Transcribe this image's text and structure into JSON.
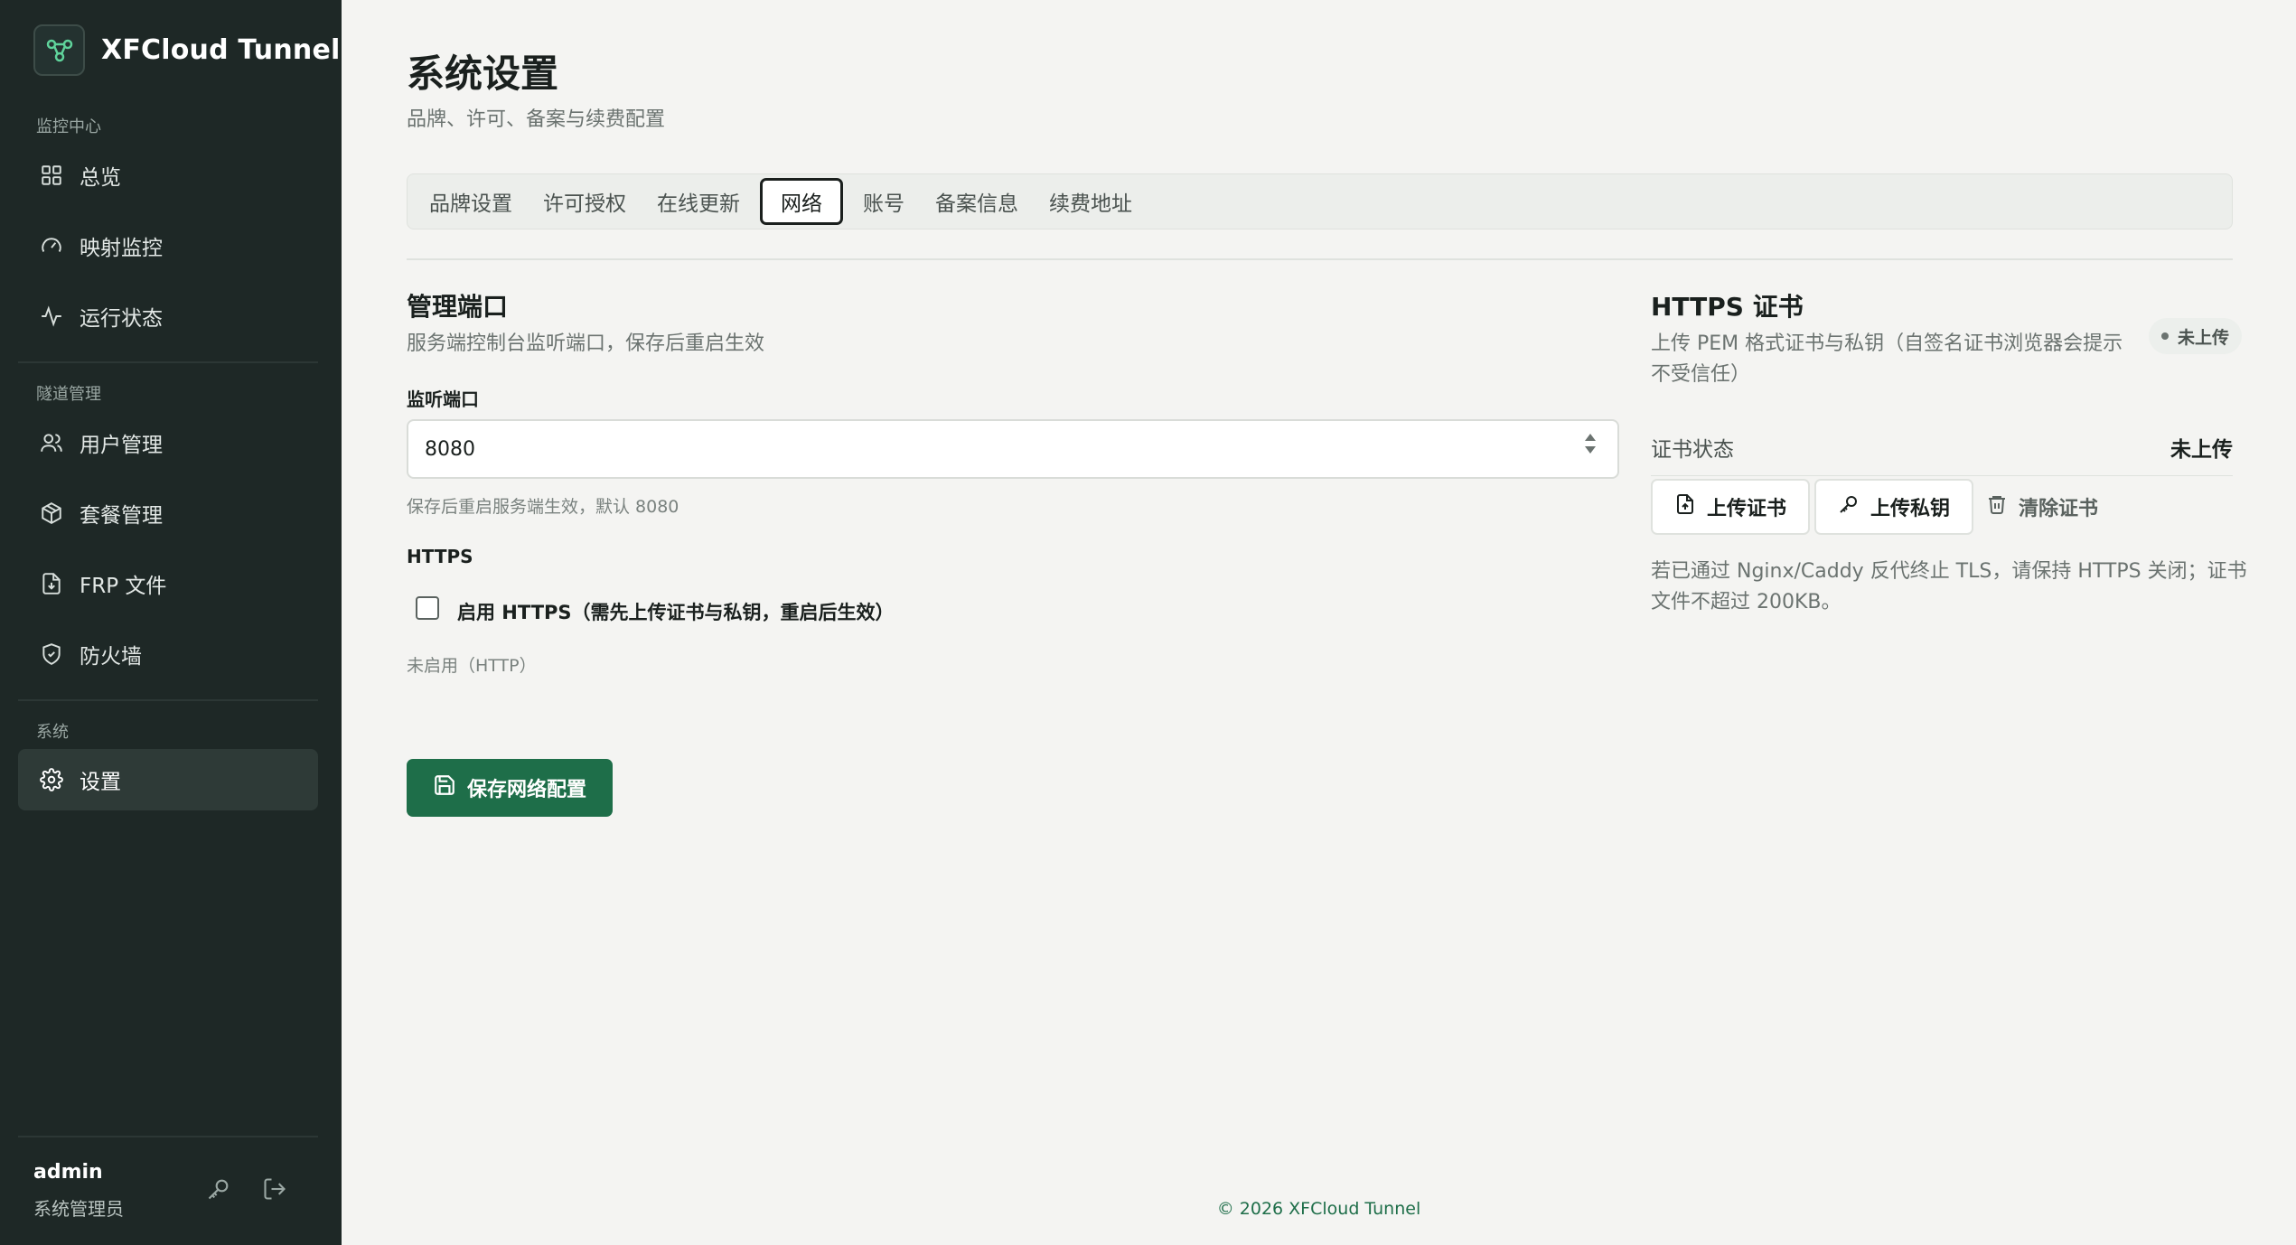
{
  "app": {
    "name": "XFCloud Tunnel"
  },
  "sidebar": {
    "sections": [
      {
        "label": "监控中心",
        "items": [
          {
            "label": "总览",
            "icon": "grid-icon"
          },
          {
            "label": "映射监控",
            "icon": "gauge-icon"
          },
          {
            "label": "运行状态",
            "icon": "activity-icon"
          }
        ]
      },
      {
        "label": "隧道管理",
        "items": [
          {
            "label": "用户管理",
            "icon": "users-icon"
          },
          {
            "label": "套餐管理",
            "icon": "package-icon"
          },
          {
            "label": "FRP 文件",
            "icon": "file-download-icon"
          },
          {
            "label": "防火墙",
            "icon": "shield-icon"
          }
        ]
      },
      {
        "label": "系统",
        "items": [
          {
            "label": "设置",
            "icon": "gear-icon",
            "active": true
          }
        ]
      }
    ],
    "user": {
      "name": "admin",
      "role": "系统管理员"
    }
  },
  "page": {
    "title": "系统设置",
    "subtitle": "品牌、许可、备案与续费配置"
  },
  "tabs": [
    {
      "label": "品牌设置"
    },
    {
      "label": "许可授权"
    },
    {
      "label": "在线更新"
    },
    {
      "label": "网络",
      "active": true
    },
    {
      "label": "账号"
    },
    {
      "label": "备案信息"
    },
    {
      "label": "续费地址"
    }
  ],
  "port_section": {
    "title": "管理端口",
    "desc": "服务端控制台监听端口，保存后重启生效",
    "field_label": "监听端口",
    "port_value": "8080",
    "hint": "保存后重启服务端生效，默认 8080"
  },
  "https_section": {
    "label": "HTTPS",
    "checkbox_label": "启用 HTTPS（需先上传证书与私钥，重启后生效）",
    "checked": false,
    "status_hint": "未启用（HTTP）"
  },
  "save_button": {
    "label": "保存网络配置"
  },
  "cert_section": {
    "title": "HTTPS 证书",
    "desc": "上传 PEM 格式证书与私钥（自签名证书浏览器会提示不受信任）",
    "badge": "未上传",
    "status_label": "证书状态",
    "status_value": "未上传",
    "upload_cert": "上传证书",
    "upload_key": "上传私钥",
    "clear_cert": "清除证书",
    "note": "若已通过 Nginx/Caddy 反代终止 TLS，请保持 HTTPS 关闭；证书文件不超过 200KB。"
  },
  "footer": {
    "text": "© 2026 XFCloud Tunnel"
  },
  "colors": {
    "sidebar_bg": "#1e2826",
    "accent": "#1e6e49",
    "page_bg": "#f4f4f2"
  }
}
